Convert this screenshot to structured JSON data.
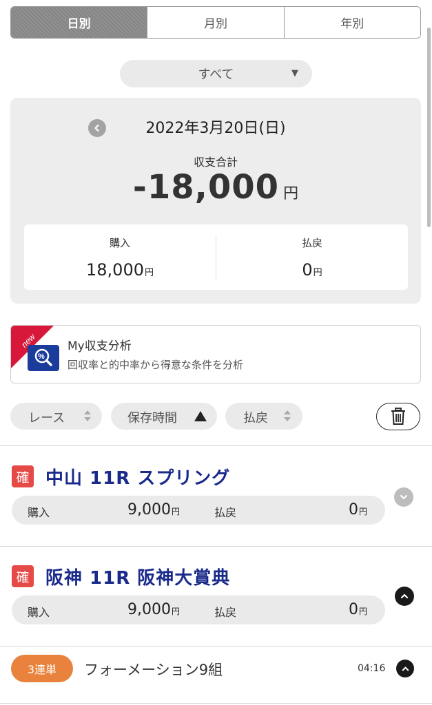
{
  "tabs": [
    {
      "label": "日別",
      "active": true
    },
    {
      "label": "月別",
      "active": false
    },
    {
      "label": "年別",
      "active": false
    }
  ],
  "filter": {
    "selected": "すべて",
    "caret": "▼"
  },
  "summary": {
    "date": "2022年3月20日(日)",
    "total_label": "収支合計",
    "total_value": "-18,000",
    "total_unit": "円",
    "purchase_label": "購入",
    "purchase_value": "18,000",
    "payout_label": "払戻",
    "payout_value": "0",
    "unit": "円"
  },
  "analysis": {
    "badge": "new",
    "title": "My収支分析",
    "description": "回収率と的中率から得意な条件を分析"
  },
  "sort": {
    "race_label": "レース",
    "saved_time_label": "保存時間",
    "payout_label": "払戻"
  },
  "races": [
    {
      "status": "確",
      "title": "中山 11R スプリング",
      "purchase_label": "購入",
      "purchase_value": "9,000",
      "payout_label": "払戻",
      "payout_value": "0",
      "unit": "円"
    },
    {
      "status": "確",
      "title": "阪神 11R 阪神大賞典",
      "purchase_label": "購入",
      "purchase_value": "9,000",
      "payout_label": "払戻",
      "payout_value": "0",
      "unit": "円"
    }
  ],
  "bet": {
    "type": "3連単",
    "description": "フォーメーション9組",
    "time": "04:16"
  },
  "colors": {
    "accent_blue": "#1a2a8a",
    "status_red": "#e64a47",
    "bet_orange": "#e8823c",
    "new_red": "#d8183a"
  }
}
